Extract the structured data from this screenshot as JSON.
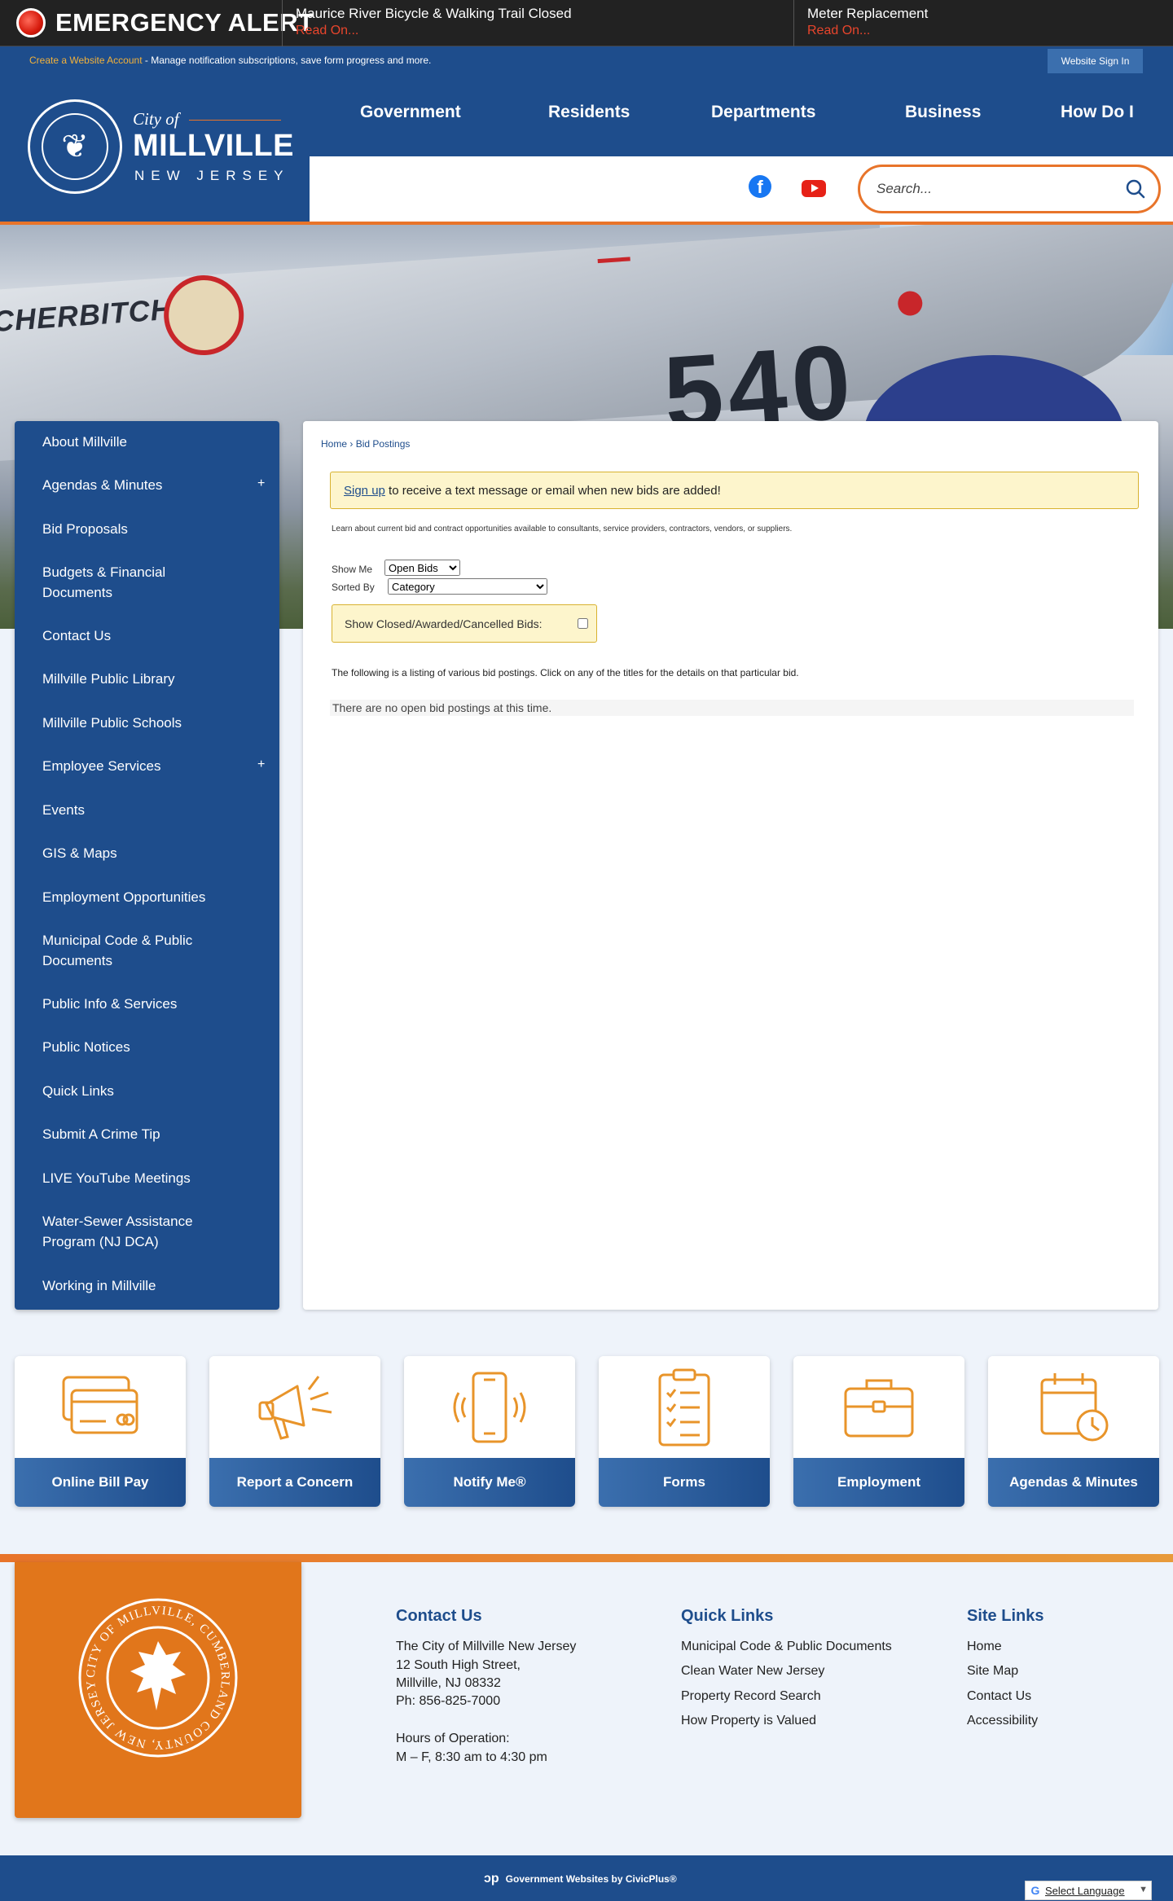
{
  "alerts": {
    "title": "EMERGENCY ALERT",
    "items": [
      {
        "title": "Maurice River Bicycle & Walking Trail Closed",
        "read_more": "Read On..."
      },
      {
        "title": "Meter Replacement",
        "read_more": "Read On..."
      }
    ]
  },
  "account_bar": {
    "create_link": "Create a Website Account",
    "description": " - Manage notification subscriptions, save form progress and more.",
    "sign_in": "Website Sign In"
  },
  "logo": {
    "city_of": "City of",
    "name": "MILLVILLE",
    "state": "NEW JERSEY"
  },
  "nav": [
    "Government",
    "Residents",
    "Departments",
    "Business",
    "How Do I"
  ],
  "search": {
    "placeholder": "Search..."
  },
  "banner": {
    "painted_text": "ITCHERBITCHIN",
    "number": "540"
  },
  "sidebar": {
    "items": [
      {
        "label": "About Millville",
        "expandable": false
      },
      {
        "label": "Agendas & Minutes",
        "expandable": true
      },
      {
        "label": "Bid Proposals",
        "expandable": false
      },
      {
        "label": "Budgets & Financial Documents",
        "expandable": false
      },
      {
        "label": "Contact Us",
        "expandable": false
      },
      {
        "label": "Millville Public Library",
        "expandable": false
      },
      {
        "label": "Millville Public Schools",
        "expandable": false
      },
      {
        "label": "Employee Services",
        "expandable": true
      },
      {
        "label": "Events",
        "expandable": false
      },
      {
        "label": "GIS & Maps",
        "expandable": false
      },
      {
        "label": "Employment Opportunities",
        "expandable": false
      },
      {
        "label": "Municipal Code & Public Documents",
        "expandable": false
      },
      {
        "label": "Public Info & Services",
        "expandable": false
      },
      {
        "label": "Public Notices",
        "expandable": false
      },
      {
        "label": "Quick Links",
        "expandable": false
      },
      {
        "label": "Submit A Crime Tip",
        "expandable": false
      },
      {
        "label": "LIVE YouTube Meetings",
        "expandable": false
      },
      {
        "label": "Water-Sewer Assistance Program (NJ DCA)",
        "expandable": false
      },
      {
        "label": "Working in Millville",
        "expandable": false
      }
    ],
    "expand_symbol": "+"
  },
  "content": {
    "breadcrumb": {
      "home": "Home",
      "separator": " › ",
      "current": "Bid Postings"
    },
    "notice_link": "Sign up",
    "notice_text": " to receive a text message or email when new bids are added!",
    "learn": "Learn about current bid and contract opportunities available to consultants, service providers, contractors, vendors, or suppliers.",
    "show_me_label": "Show Me",
    "show_me_value": "Open Bids",
    "sorted_by_label": "Sorted By",
    "sorted_by_value": "Category",
    "closed_label": "Show Closed/Awarded/Cancelled Bids:",
    "listing": "The following is a listing of various bid postings. Click on any of the titles for the details on that particular bid.",
    "no_bids": "There are no open bid postings at this time."
  },
  "tiles": [
    {
      "label": "Online Bill Pay",
      "icon": "credit-card-icon"
    },
    {
      "label": "Report a Concern",
      "icon": "megaphone-icon"
    },
    {
      "label": "Notify Me®",
      "icon": "phone-icon"
    },
    {
      "label": "Forms",
      "icon": "clipboard-icon"
    },
    {
      "label": "Employment",
      "icon": "briefcase-icon"
    },
    {
      "label": "Agendas & Minutes",
      "icon": "calendar-clock-icon"
    }
  ],
  "footer": {
    "seal_text": "CITY OF MILLVILLE, CUMBERLAND COUNTY, NEW JERSEY",
    "contact": {
      "title": "Contact Us",
      "lines": [
        "The City of Millville New Jersey",
        "12 South High Street,",
        "Millville, NJ 08332",
        "Ph: 856-825-7000"
      ],
      "hours_title": "Hours of Operation:",
      "hours": "M – F, 8:30 am to 4:30 pm"
    },
    "quick_links": {
      "title": "Quick Links",
      "items": [
        "Municipal Code & Public Documents",
        "Clean Water New Jersey",
        "Property Record Search",
        "How Property is Valued"
      ]
    },
    "site_links": {
      "title": "Site Links",
      "items": [
        "Home",
        "Site Map",
        "Contact Us",
        "Accessibility"
      ]
    },
    "civic": "Government Websites by CivicPlus®",
    "language": "Select Language"
  },
  "colors": {
    "primary": "#1e4d8c",
    "accent": "#e8742a",
    "alert_red": "#e8452c"
  }
}
